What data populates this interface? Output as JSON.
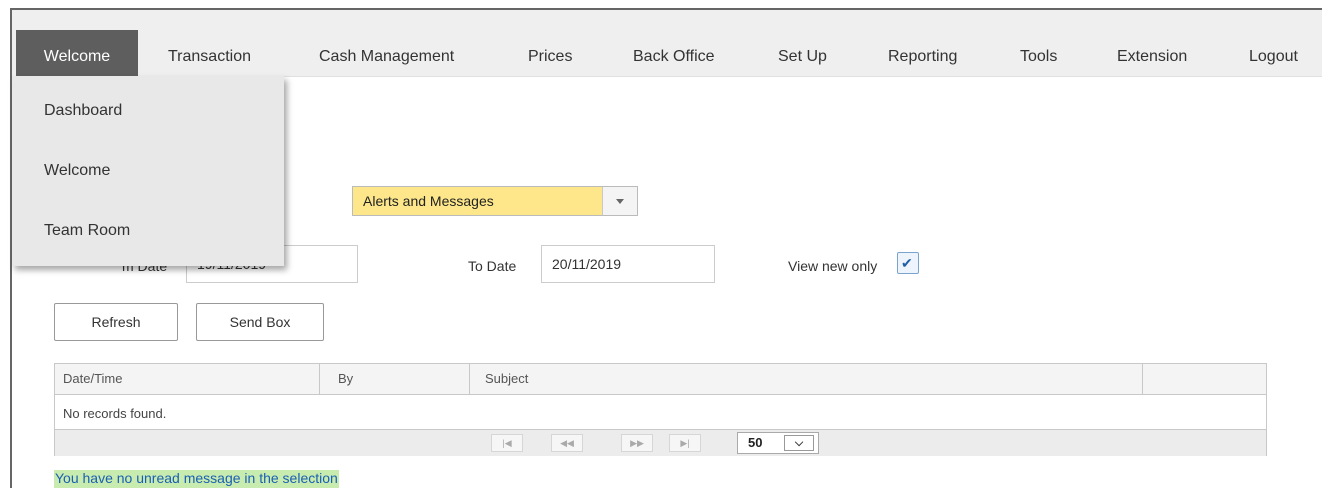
{
  "menu": {
    "items": [
      "Welcome",
      "Transaction",
      "Cash Management",
      "Prices",
      "Back Office",
      "Set Up",
      "Reporting",
      "Tools",
      "Extension",
      "Logout"
    ],
    "active": "Welcome"
  },
  "dropdown": {
    "items": [
      "Dashboard",
      "Welcome",
      "Team Room"
    ]
  },
  "filter": {
    "category_value": "Alerts and Messages",
    "from_date_label": "m Date",
    "from_date_value": "19/11/2019",
    "to_date_label": "To Date",
    "to_date_value": "20/11/2019",
    "view_new_only_label": "View new only",
    "view_new_only_checked": true
  },
  "buttons": {
    "refresh": "Refresh",
    "send_box": "Send Box"
  },
  "grid": {
    "columns": [
      "Date/Time",
      "By",
      "Subject"
    ],
    "empty_text": "No records found.",
    "page_size": "50"
  },
  "status_message": "You have no unread message in the selection",
  "colors": {
    "menu_active_bg": "#5e5e5e",
    "select_bg": "#fde78a",
    "status_highlight": "#c8ecb0",
    "status_text": "#1a5fb4"
  }
}
